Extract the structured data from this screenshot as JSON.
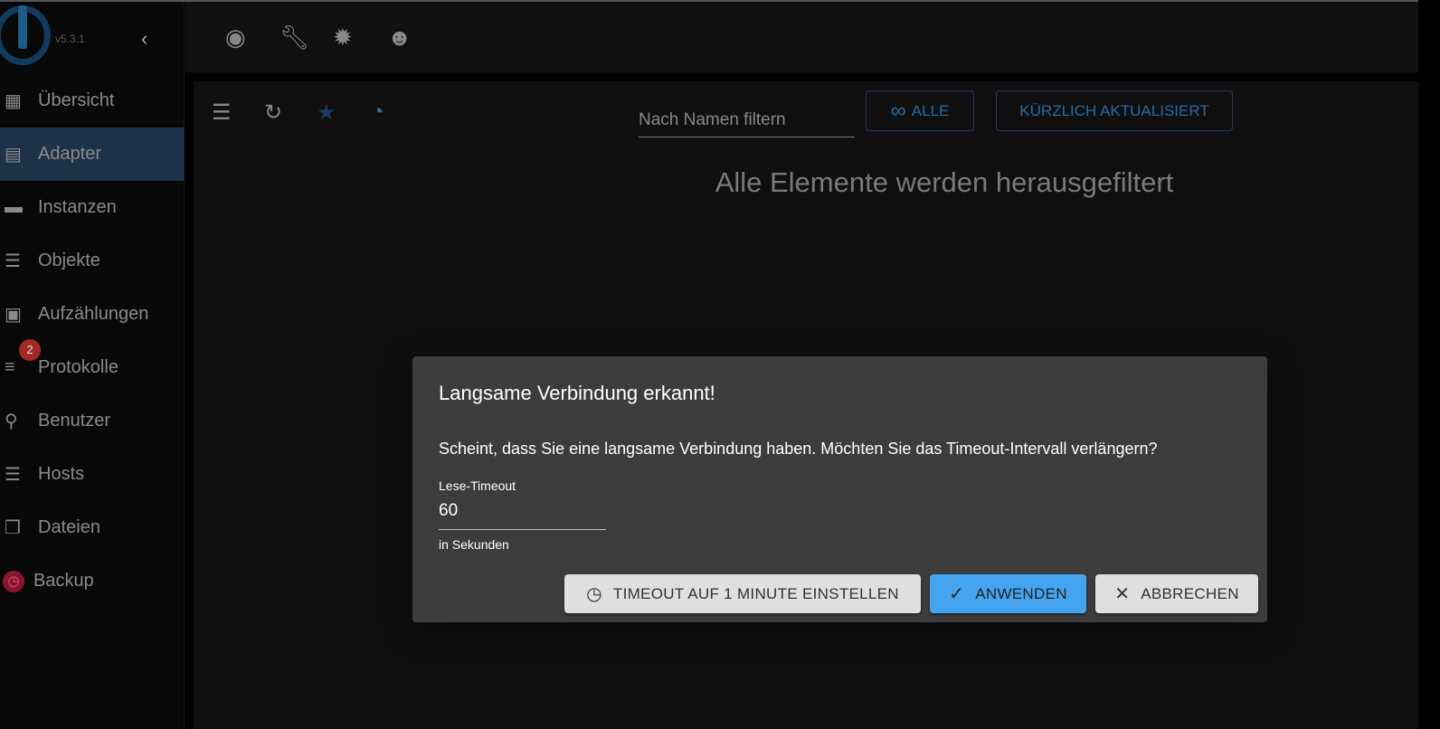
{
  "app": {
    "version": "v5.3.1"
  },
  "sidebar": {
    "items": [
      {
        "label": "Übersicht",
        "icon": "grid-icon",
        "glyph": "▦"
      },
      {
        "label": "Adapter",
        "icon": "store-icon",
        "glyph": "▤"
      },
      {
        "label": "Instanzen",
        "icon": "subtitles-icon",
        "glyph": "▬"
      },
      {
        "label": "Objekte",
        "icon": "list-icon",
        "glyph": "☰"
      },
      {
        "label": "Aufzählungen",
        "icon": "enum-icon",
        "glyph": "▣"
      },
      {
        "label": "Protokolle",
        "icon": "log-icon",
        "glyph": "≡",
        "badge": "2"
      },
      {
        "label": "Benutzer",
        "icon": "person-icon",
        "glyph": "⚲"
      },
      {
        "label": "Hosts",
        "icon": "storage-icon",
        "glyph": "☰"
      },
      {
        "label": "Dateien",
        "icon": "files-icon",
        "glyph": "❐"
      },
      {
        "label": "Backup",
        "icon": "backup-icon",
        "glyph": "◷"
      }
    ],
    "active": "Adapter"
  },
  "main": {
    "filter_placeholder": "Nach Namen filtern",
    "all_button": "ALLE",
    "recent_button": "KÜRZLICH AKTUALISIERT",
    "empty_message": "Alle Elemente werden herausgefiltert"
  },
  "dialog": {
    "title": "Langsame Verbindung erkannt!",
    "text": "Scheint, dass Sie eine langsame Verbindung haben. Möchten Sie das Timeout-Intervall verlängern?",
    "field_label": "Lese-Timeout",
    "field_value": "60",
    "field_helper": "in Sekunden",
    "btn_timeout": "TIMEOUT AUF 1 MINUTE EINSTELLEN",
    "btn_apply": "ANWENDEN",
    "btn_cancel": "ABBRECHEN"
  },
  "colors": {
    "accent": "#44a4f0",
    "active_nav": "#1d3248",
    "badge": "#a02a22"
  }
}
